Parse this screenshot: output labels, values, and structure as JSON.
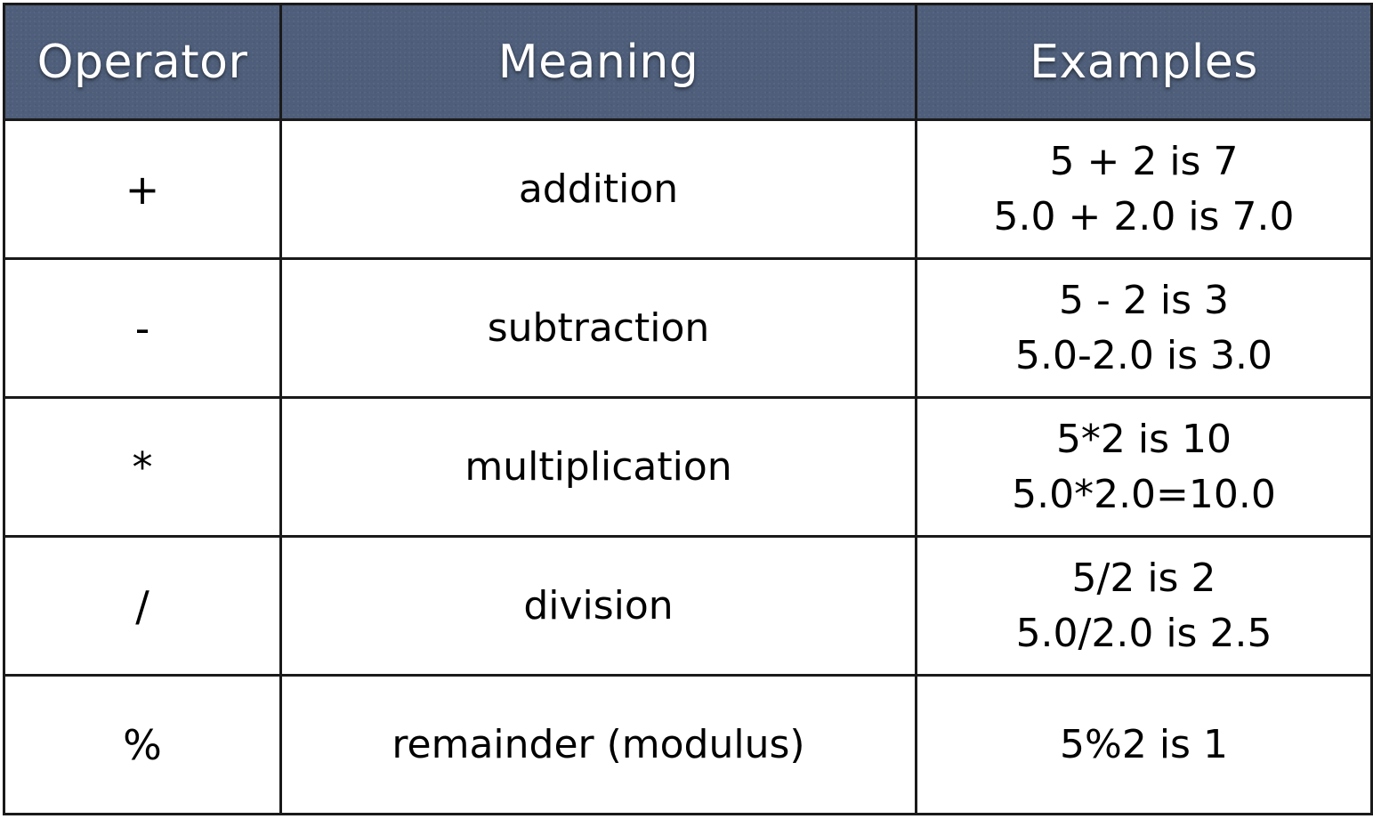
{
  "table": {
    "headers": {
      "operator": "Operator",
      "meaning": "Meaning",
      "examples": "Examples"
    },
    "rows": [
      {
        "operator": "+",
        "meaning": "addition",
        "examples": [
          "5 + 2 is 7",
          "5.0 + 2.0 is 7.0"
        ]
      },
      {
        "operator": "-",
        "meaning": "subtraction",
        "examples": [
          "5 - 2 is 3",
          "5.0-2.0 is 3.0"
        ]
      },
      {
        "operator": "*",
        "meaning": "multiplication",
        "examples": [
          "5*2 is 10",
          "5.0*2.0=10.0"
        ]
      },
      {
        "operator": "/",
        "meaning": "division",
        "examples": [
          "5/2 is 2",
          "5.0/2.0 is 2.5"
        ]
      },
      {
        "operator": "%",
        "meaning": "remainder (modulus)",
        "examples": [
          "5%2 is 1"
        ]
      }
    ]
  },
  "colors": {
    "header_background": "#4f5f7b",
    "header_text": "#ffffff",
    "border": "#1a1a1a",
    "cell_background": "#ffffff"
  }
}
